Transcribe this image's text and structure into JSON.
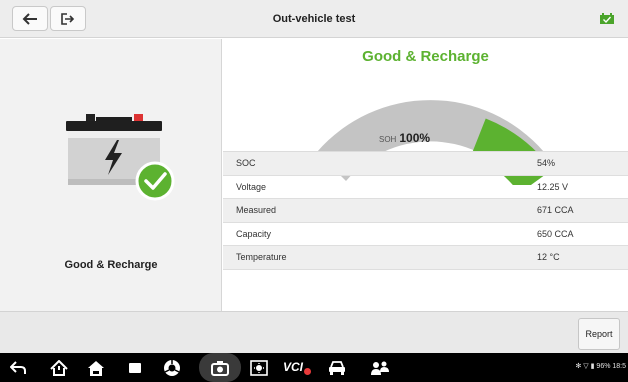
{
  "header": {
    "title": "Out-vehicle test",
    "battery_icon": "battery-ok-icon",
    "back_icon": "back-arrow-icon",
    "exit_icon": "exit-icon"
  },
  "left_panel": {
    "illustration": "battery-good-icon",
    "status_label": "Good & Recharge"
  },
  "result": {
    "status": "Good & Recharge",
    "status_color": "#5cb230",
    "soh_label": "SOH",
    "soh_value": "100%",
    "soh_fraction": 1.0
  },
  "table": {
    "rows": [
      {
        "label": "SOC",
        "value": "54%"
      },
      {
        "label": "Voltage",
        "value": "12.25 V"
      },
      {
        "label": "Measured",
        "value": "671 CCA"
      },
      {
        "label": "Capacity",
        "value": "650 CCA"
      },
      {
        "label": "Temperature",
        "value": "12 °C"
      }
    ]
  },
  "footer": {
    "report_label": "Report"
  },
  "system_bar": {
    "icons": [
      "back-icon",
      "home-icon",
      "vehicle-home-icon",
      "recent-apps-icon",
      "browser-icon",
      "screenshot-icon",
      "display-icon",
      "vci-icon",
      "car-icon",
      "remote-support-icon"
    ],
    "vci_label": "VCI",
    "status_text": "✻ ▽ ▮ 96% 18:5"
  },
  "colors": {
    "accent_green": "#5cb230",
    "gauge_gray": "#c4c4c4",
    "error_red": "#e83a3a"
  }
}
